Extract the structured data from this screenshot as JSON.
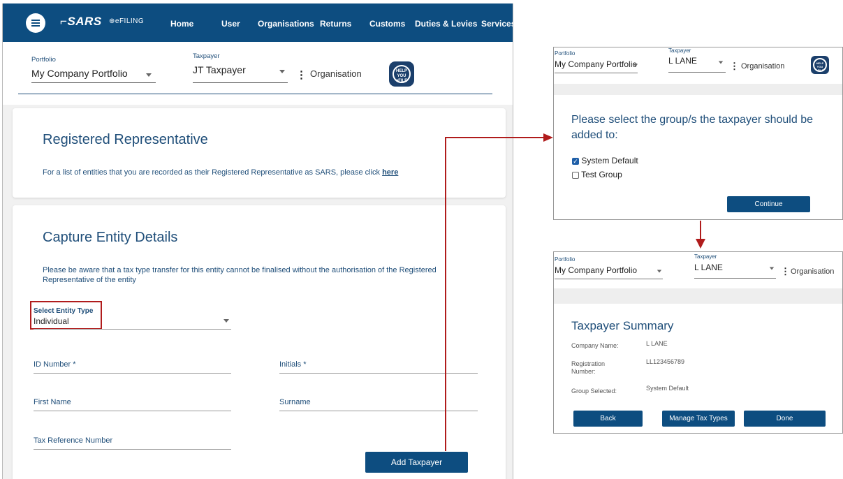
{
  "nav": {
    "logo": "SARS",
    "efiling": "eFILING",
    "items": [
      "Home",
      "User",
      "Organisations",
      "Returns",
      "Customs",
      "Duties & Levies",
      "Services"
    ]
  },
  "selectors": {
    "portfolio_label": "Portfolio",
    "portfolio_value": "My Company Portfolio",
    "taxpayer_label": "Taxpayer",
    "taxpayer_value": "JT Taxpayer",
    "organisation": "Organisation",
    "help_badge": "HELP YOU eFILE"
  },
  "registered_rep": {
    "title": "Registered Representative",
    "text": "For a list of entities that you are recorded as their Registered Representative as SARS, please click",
    "link": "here"
  },
  "capture": {
    "title": "Capture Entity Details",
    "notice": "Please be aware that a tax type transfer for this entity cannot be finalised without the authorisation of the Registered Representative of the entity",
    "entity_type_label": "Select Entity Type",
    "entity_type_value": "Individual",
    "id_number": "ID Number *",
    "initials": "Initials *",
    "first_name": "First Name",
    "surname": "Surname",
    "tax_ref": "Tax Reference Number",
    "add_button": "Add Taxpayer"
  },
  "group_panel": {
    "portfolio_label": "Portfolio",
    "portfolio_value": "My Company Portfolio",
    "taxpayer_label": "Taxpayer",
    "taxpayer_value": "L LANE",
    "organisation": "Organisation",
    "prompt": "Please select the group/s the taxpayer should be added to:",
    "options": [
      {
        "label": "System Default",
        "checked": true
      },
      {
        "label": "Test Group",
        "checked": false
      }
    ],
    "continue": "Continue"
  },
  "summary_panel": {
    "portfolio_label": "Portfolio",
    "portfolio_value": "My Company Portfolio",
    "taxpayer_label": "Taxpayer",
    "taxpayer_value": "L LANE",
    "organisation": "Organisation",
    "title": "Taxpayer Summary",
    "rows": [
      {
        "label": "Company Name:",
        "value": "L LANE"
      },
      {
        "label": "Registration Number:",
        "value": "LL123456789"
      },
      {
        "label": "Group Selected:",
        "value": "System Default"
      }
    ],
    "back": "Back",
    "manage": "Manage Tax Types",
    "done": "Done"
  },
  "colors": {
    "brand": "#0d4d80",
    "heading": "#1f4e79",
    "annotation": "#b01c1c"
  }
}
